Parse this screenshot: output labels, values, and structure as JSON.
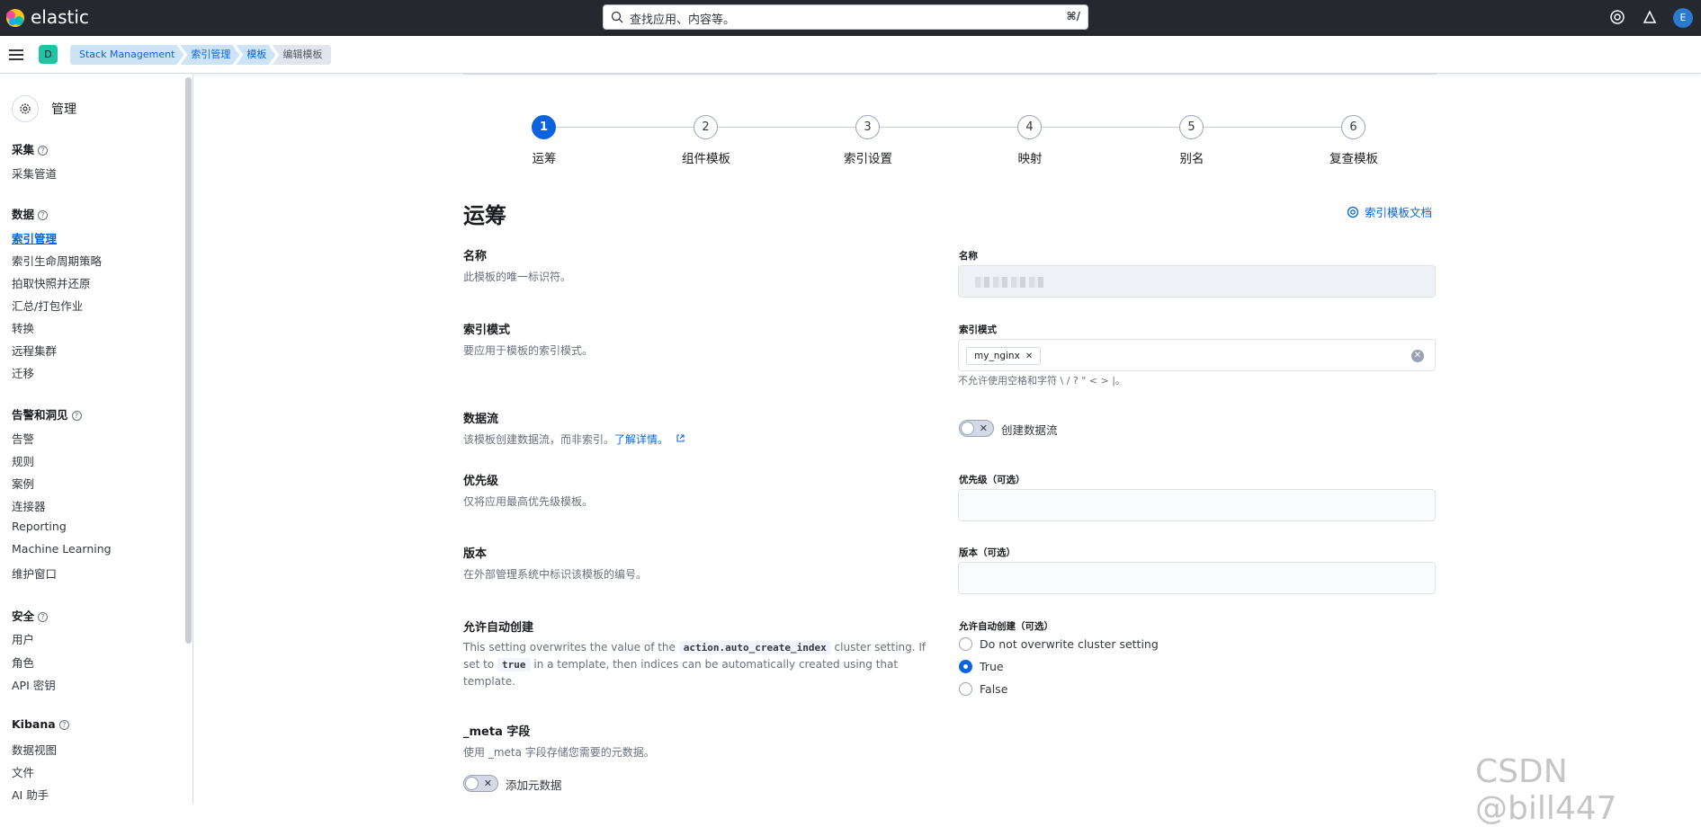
{
  "app": {
    "brand": "elastic",
    "user_initial": "E",
    "space_initial": "D"
  },
  "search": {
    "placeholder": "查找应用、内容等。",
    "shortcut": "⌘/"
  },
  "breadcrumbs": [
    "Stack Management",
    "索引管理",
    "模板",
    "编辑模板"
  ],
  "sidebar": {
    "title": "管理",
    "sections": [
      {
        "label": "采集",
        "items": [
          "采集管道"
        ]
      },
      {
        "label": "数据",
        "items": [
          "索引管理",
          "索引生命周期策略",
          "拍取快照并还原",
          "汇总/打包作业",
          "转换",
          "远程集群",
          "迁移"
        ]
      },
      {
        "label": "告警和洞见",
        "items": [
          "告警",
          "规则",
          "案例",
          "连接器",
          "Reporting",
          "Machine Learning",
          "维护窗口"
        ]
      },
      {
        "label": "安全",
        "items": [
          "用户",
          "角色",
          "API 密钥"
        ]
      },
      {
        "label": "Kibana",
        "items": [
          "数据视图",
          "文件",
          "AI 助手"
        ]
      }
    ],
    "active_item": "索引管理"
  },
  "steps": [
    {
      "num": "1",
      "label": "运筹",
      "active": true
    },
    {
      "num": "2",
      "label": "组件模板"
    },
    {
      "num": "3",
      "label": "索引设置"
    },
    {
      "num": "4",
      "label": "映射"
    },
    {
      "num": "5",
      "label": "别名"
    },
    {
      "num": "6",
      "label": "复查模板"
    }
  ],
  "page": {
    "title": "运筹",
    "doc_link": "索引模板文档"
  },
  "form": {
    "name": {
      "label": "名称",
      "desc": "此模板的唯一标识符。",
      "field_label": "名称"
    },
    "index_patterns": {
      "label": "索引模式",
      "desc": "要应用于模板的索引模式。",
      "field_label": "索引模式",
      "chip": "my_nginx",
      "help": "不允许使用空格和字符 \\ / ? \" < > |。"
    },
    "data_stream": {
      "label": "数据流",
      "desc": "该模板创建数据流，而非索引。",
      "learn_more": "了解详情。",
      "toggle_label": "创建数据流"
    },
    "priority": {
      "label": "优先级",
      "desc": "仅将应用最高优先级模板。",
      "field_label": "优先级（可选）"
    },
    "version": {
      "label": "版本",
      "desc": "在外部管理系统中标识该模板的编号。",
      "field_label": "版本（可选）"
    },
    "auto_create": {
      "label": "允许自动创建",
      "desc_1": "This setting overwrites the value of the",
      "code_1": "action.auto_create_index",
      "desc_2": "cluster setting. If set to",
      "code_2": "true",
      "desc_3": "in a template, then indices can be automatically created using that template.",
      "field_label": "允许自动创建（可选）",
      "options": [
        "Do not overwrite cluster setting",
        "True",
        "False"
      ],
      "selected": "True"
    },
    "meta": {
      "label": "_meta 字段",
      "desc": "使用 _meta 字段存储您需要的元数据。",
      "toggle_label": "添加元数据"
    }
  },
  "watermark": "CSDN @bill447",
  "colors": {
    "accent": "#0b64dd",
    "topbar": "#25282f",
    "space_badge": "#21c3a3"
  }
}
